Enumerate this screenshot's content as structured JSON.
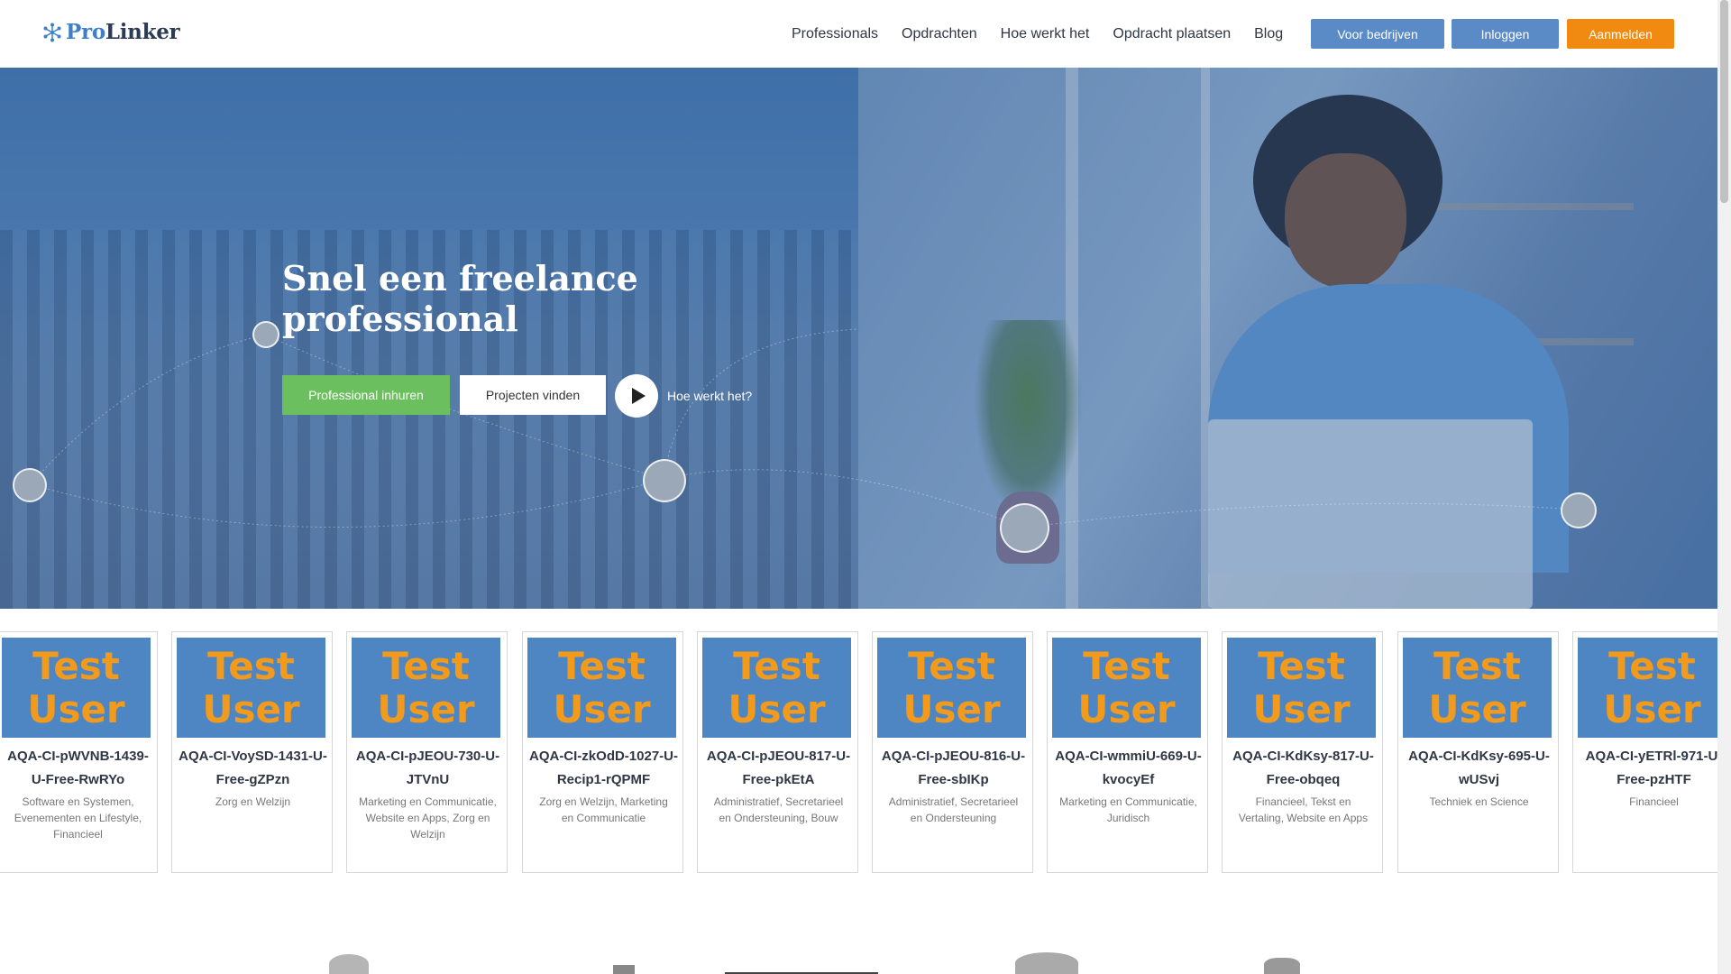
{
  "header": {
    "logo_pro": "Pro",
    "logo_linker": "Linker",
    "nav": [
      "Professionals",
      "Opdrachten",
      "Hoe werkt het",
      "Opdracht plaatsen",
      "Blog"
    ],
    "btn_bedrijven": "Voor bedrijven",
    "btn_inloggen": "Inloggen",
    "btn_aanmelden": "Aanmelden"
  },
  "hero": {
    "title": "Snel een freelance professional",
    "btn_hire": "Professional inhuren",
    "btn_find": "Projecten vinden",
    "how_label": "Hoe werkt het?"
  },
  "cards": [
    {
      "img_line1": "Test",
      "img_line2": "User",
      "name": "AQA-CI-pWVNB-1439-U-Free-RwRYo",
      "category": "Software en Systemen, Evenementen en Lifestyle, Financieel"
    },
    {
      "img_line1": "Test",
      "img_line2": "User",
      "name": "AQA-CI-VoySD-1431-U-Free-gZPzn",
      "category": "Zorg en Welzijn"
    },
    {
      "img_line1": "Test",
      "img_line2": "User",
      "name": "AQA-CI-pJEOU-730-U-JTVnU",
      "category": "Marketing en Communicatie, Website en Apps, Zorg en Welzijn"
    },
    {
      "img_line1": "Test",
      "img_line2": "User",
      "name": "AQA-CI-zkOdD-1027-U-Recip1-rQPMF",
      "category": "Zorg en Welzijn, Marketing en Communicatie"
    },
    {
      "img_line1": "Test",
      "img_line2": "User",
      "name": "AQA-CI-pJEOU-817-U-Free-pkEtA",
      "category": "Administratief, Secretarieel en Ondersteuning, Bouw"
    },
    {
      "img_line1": "Test",
      "img_line2": "User",
      "name": "AQA-CI-pJEOU-816-U-Free-sbIKp",
      "category": "Administratief, Secretarieel en Ondersteuning"
    },
    {
      "img_line1": "Test",
      "img_line2": "User",
      "name": "AQA-CI-wmmiU-669-U-kvocyEf",
      "category": "Marketing en Communicatie, Juridisch"
    },
    {
      "img_line1": "Test",
      "img_line2": "User",
      "name": "AQA-CI-KdKsy-817-U-Free-obqeq",
      "category": "Financieel, Tekst en Vertaling, Website en Apps"
    },
    {
      "img_line1": "Test",
      "img_line2": "User",
      "name": "AQA-CI-KdKsy-695-U-wUSvj",
      "category": "Techniek en Science"
    },
    {
      "img_line1": "Test",
      "img_line2": "User",
      "name": "AQA-CI-yETRl-971-U-Free-pzHTF",
      "category": "Financieel"
    }
  ],
  "colors": {
    "accent_blue": "#5b8bc7",
    "accent_orange": "#f08a10",
    "hire_green": "#6cbf5f",
    "card_img_bg": "#4e86c4",
    "card_img_text": "#f19a1c"
  },
  "icons": {
    "logo_mark": "network-snowflake-icon",
    "play": "play-icon"
  }
}
